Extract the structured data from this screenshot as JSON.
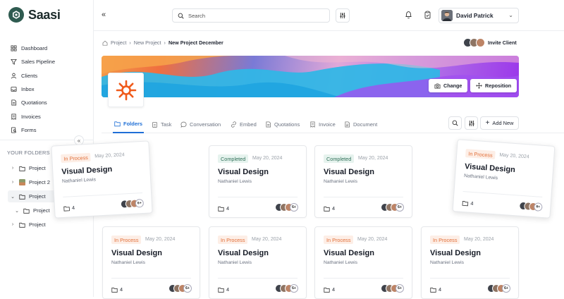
{
  "app": {
    "name": "Saasi"
  },
  "sidebar": {
    "items": [
      {
        "label": "Dashboard",
        "icon": "grid-icon"
      },
      {
        "label": "Sales Pipeline",
        "icon": "funnel-icon"
      },
      {
        "label": "Clients",
        "icon": "user-icon"
      },
      {
        "label": "Inbox",
        "icon": "inbox-icon"
      },
      {
        "label": "Quotations",
        "icon": "document-icon"
      },
      {
        "label": "Invoices",
        "icon": "invoice-icon"
      },
      {
        "label": "Forms",
        "icon": "form-icon"
      }
    ],
    "folders_title": "YOUR FOLDERS",
    "folders": [
      {
        "label": "Project"
      },
      {
        "label": "Project 2"
      },
      {
        "label": "Project"
      },
      {
        "label": "Project"
      },
      {
        "label": "Project"
      }
    ]
  },
  "topbar": {
    "search_placeholder": "Search",
    "user_name": "David Patrick"
  },
  "breadcrumb": {
    "items": [
      "Project",
      "New Project"
    ],
    "current": "New Project December"
  },
  "invite_label": "Invite Client",
  "banner": {
    "change_label": "Change",
    "reposition_label": "Reposition"
  },
  "tabs": [
    "Folders",
    "Task",
    "Conversation",
    "Embed",
    "Quotations",
    "Invoice",
    "Document"
  ],
  "add_new_label": "Add New",
  "cards": [
    {
      "status": "In Process",
      "date": "May 20, 2024",
      "title": "Visual Design",
      "owner": "Nathaniel Lewis",
      "count": "4",
      "more": "6+"
    },
    {
      "status": "Completed",
      "date": "May 20, 2024",
      "title": "Visual Design",
      "owner": "Nathaniel Lewis",
      "count": "4",
      "more": "6+"
    },
    {
      "status": "Completed",
      "date": "May 20, 2024",
      "title": "Visual Design",
      "owner": "Nathaniel Lewis",
      "count": "4",
      "more": "6+"
    },
    {
      "status": "In Process",
      "date": "May 20, 2024",
      "title": "Visual Design",
      "owner": "Nathaniel Lewis",
      "count": "4",
      "more": "6+"
    },
    {
      "status": "In Process",
      "date": "May 20, 2024",
      "title": "Visual Design",
      "owner": "Nathaniel Lewis",
      "count": "4",
      "more": "6+"
    },
    {
      "status": "In Process",
      "date": "May 20, 2024",
      "title": "Visual Design",
      "owner": "Nathaniel Lewis",
      "count": "4",
      "more": "6+"
    },
    {
      "status": "In Process",
      "date": "May 20, 2024",
      "title": "Visual Design",
      "owner": "Nathaniel Lewis",
      "count": "4",
      "more": "6+"
    },
    {
      "status": "In Process",
      "date": "May 20, 2024",
      "title": "Visual Design",
      "owner": "Nathaniel Lewis",
      "count": "4",
      "more": "6+"
    }
  ],
  "colors": {
    "brand": "#2f5b50",
    "accent": "#1f6fd6",
    "in_process": "#e2703a",
    "completed": "#2f6f58"
  }
}
